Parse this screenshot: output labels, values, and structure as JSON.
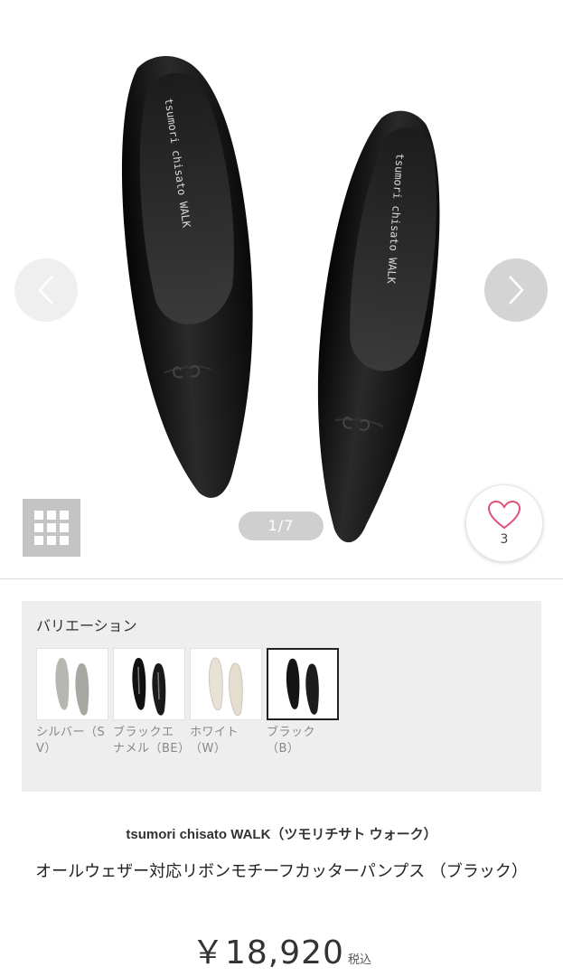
{
  "gallery": {
    "counter": "1/7",
    "favorite_count": "3",
    "shoe_brand_print": "tsumori chisato WALK",
    "icons": [
      "chevron-left-icon",
      "chevron-right-icon",
      "grid-icon",
      "heart-icon"
    ]
  },
  "variations": {
    "title": "バリエーション",
    "items": [
      {
        "label": "シルバー（SV）",
        "color": "#b8b6b0",
        "selected": false
      },
      {
        "label": "ブラックエナメル（BE）",
        "color": "#111111",
        "selected": false
      },
      {
        "label": "ホワイト（W）",
        "color": "#e8e2d6",
        "selected": false
      },
      {
        "label": "ブラック（B）",
        "color": "#141414",
        "selected": true
      }
    ]
  },
  "product": {
    "brand": "tsumori chisato WALK",
    "brand_kana": "（ツモリチサト ウォーク）",
    "name": "オールウェザー対応リボンモチーフカッターパンプス （ブラック）",
    "price": "￥18,920",
    "tax_label": "税込"
  },
  "colors": {
    "heart": "#e0517a",
    "nav_button": "#cfcfcf",
    "variation_bg": "#eeeeee"
  }
}
